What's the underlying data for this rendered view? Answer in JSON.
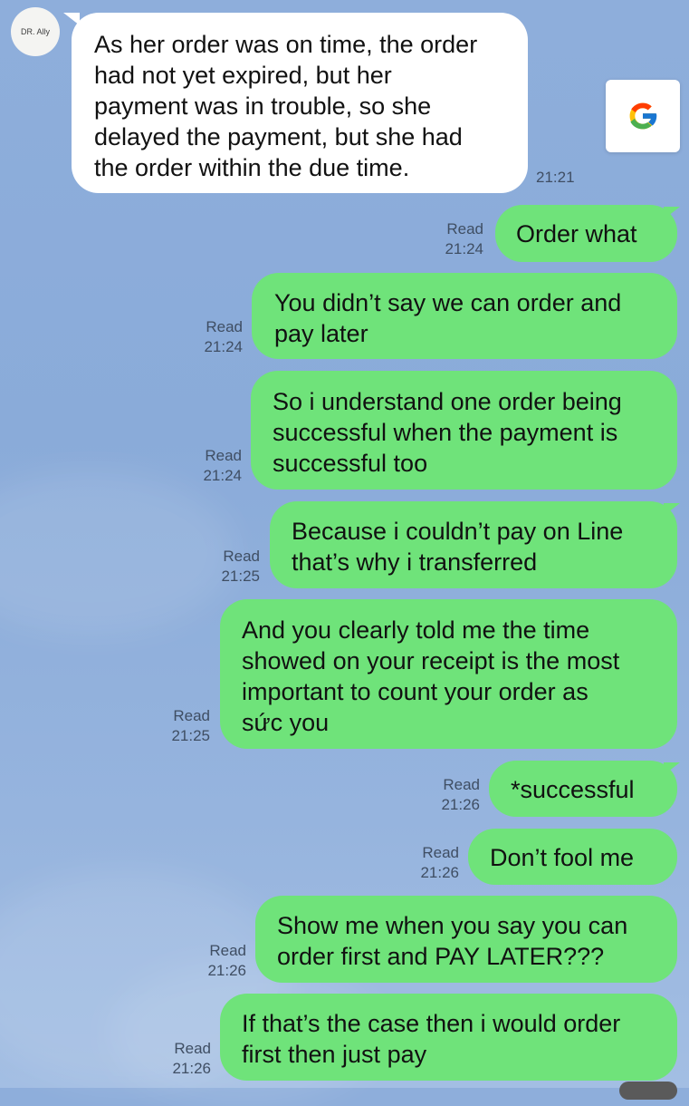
{
  "contact": {
    "avatar_text": "DR. Ally"
  },
  "colors": {
    "background": "#8aabd9",
    "incoming_bubble": "#ffffff",
    "outgoing_bubble": "#6fe37a",
    "meta_text": "#3f4e63"
  },
  "icons": {
    "google_button": "google-g-logo"
  },
  "messages": [
    {
      "direction": "incoming",
      "lines": [
        "As her order was on time, the order",
        "had not yet expired, but her",
        "payment was in trouble, so she",
        "delayed the payment, but she had",
        "the order within the due time."
      ],
      "time": "21:21"
    },
    {
      "direction": "outgoing",
      "lines": [
        "Order what"
      ],
      "status": "Read",
      "time": "21:24"
    },
    {
      "direction": "outgoing",
      "lines": [
        "You didn’t say we can order and",
        "pay later"
      ],
      "status": "Read",
      "time": "21:24"
    },
    {
      "direction": "outgoing",
      "lines": [
        "So i understand one order being",
        "successful when the payment is",
        "successful too"
      ],
      "status": "Read",
      "time": "21:24"
    },
    {
      "direction": "outgoing",
      "lines": [
        "Because i couldn’t pay on Line",
        "that’s why i transferred"
      ],
      "status": "Read",
      "time": "21:25"
    },
    {
      "direction": "outgoing",
      "lines": [
        "And you clearly told me the time",
        "showed on your receipt is the most",
        "important to count your order as",
        "sức you"
      ],
      "status": "Read",
      "time": "21:25"
    },
    {
      "direction": "outgoing",
      "lines": [
        "*successful"
      ],
      "status": "Read",
      "time": "21:26"
    },
    {
      "direction": "outgoing",
      "lines": [
        "Don’t fool me"
      ],
      "status": "Read",
      "time": "21:26"
    },
    {
      "direction": "outgoing",
      "lines": [
        "Show me when you say you can",
        "order first and PAY LATER???"
      ],
      "status": "Read",
      "time": "21:26"
    },
    {
      "direction": "outgoing",
      "lines": [
        "If that’s the case then i would order",
        "first then just pay"
      ],
      "status": "Read",
      "time": "21:26"
    }
  ]
}
